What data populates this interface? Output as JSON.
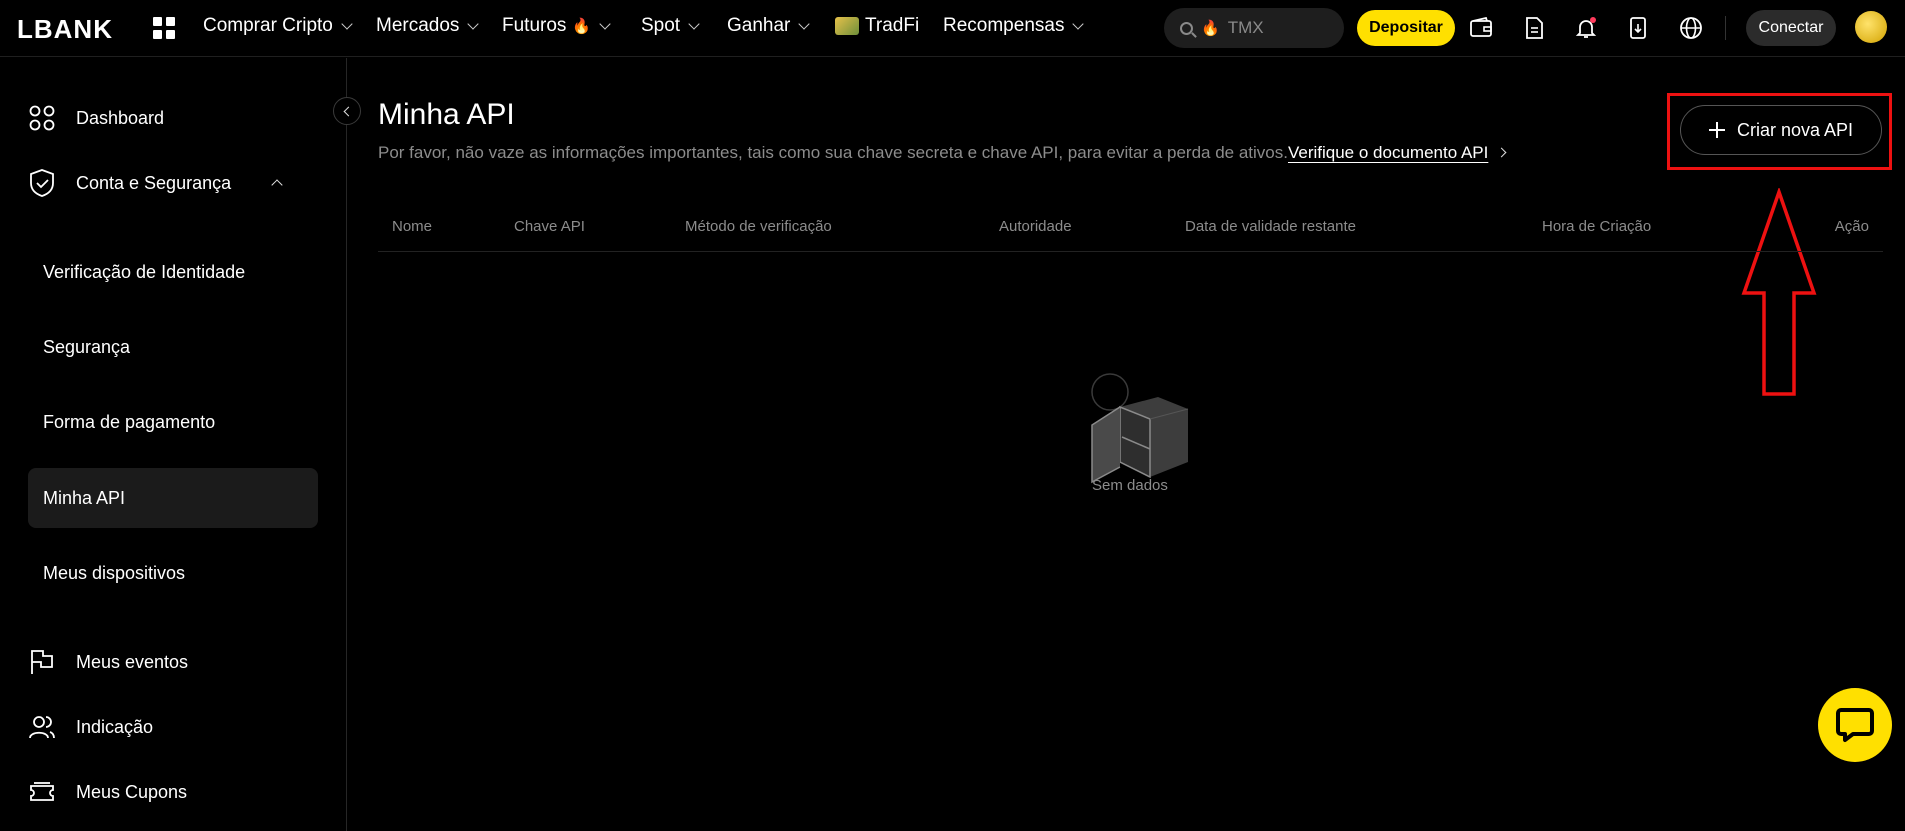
{
  "brand": {
    "logo": "LBANK"
  },
  "nav": {
    "items": [
      {
        "label": "Comprar Cripto"
      },
      {
        "label": "Mercados"
      },
      {
        "label": "Futuros"
      },
      {
        "label": "Spot"
      },
      {
        "label": "Ganhar"
      },
      {
        "label": "TradFi"
      },
      {
        "label": "Recompensas"
      }
    ],
    "search_placeholder": "TMX",
    "deposit_label": "Depositar",
    "connect_label": "Conectar"
  },
  "sidebar": {
    "dashboard": "Dashboard",
    "account_security": "Conta e Segurança",
    "sub_items": [
      {
        "label": "Verificação de Identidade"
      },
      {
        "label": "Segurança"
      },
      {
        "label": "Forma de pagamento"
      },
      {
        "label": "Minha API",
        "active": true
      },
      {
        "label": "Meus dispositivos"
      }
    ],
    "events": "Meus eventos",
    "referral": "Indicação",
    "coupons": "Meus Cupons"
  },
  "main": {
    "title": "Minha API",
    "subtitle": "Por favor, não vaze as informações importantes, tais como sua chave secreta e chave API, para evitar a perda de ativos.",
    "doc_link": "Verifique o documento API",
    "create_button": "Criar nova API",
    "table_headers": [
      "Nome",
      "Chave API",
      "Método de verificação",
      "Autoridade",
      "Data de validade restante",
      "Hora de Criação",
      "Ação"
    ],
    "empty_text": "Sem dados"
  },
  "colors": {
    "accent": "#ffe000",
    "annotation": "#ee1111",
    "background": "#000000"
  }
}
